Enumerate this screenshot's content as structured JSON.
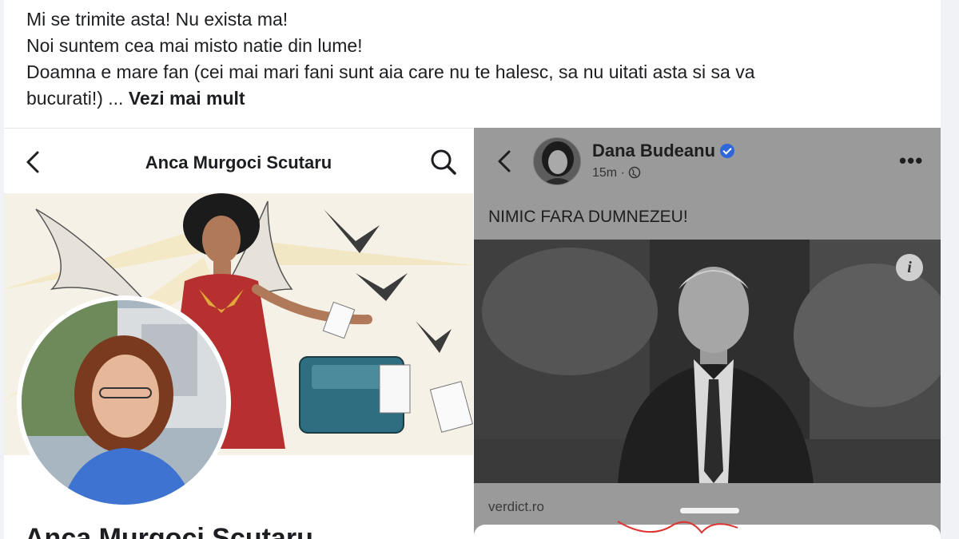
{
  "post": {
    "lines": [
      "Mi se trimite asta! Nu exista ma!",
      "Noi suntem cea mai misto natie din lume!",
      "Doamna e mare fan (cei mai mari fani sunt aia care nu te halesc, sa nu uitati asta si sa va",
      "bucurati!) ... "
    ],
    "see_more": "Vezi mai mult"
  },
  "left_screenshot": {
    "header_title": "Anca Murgoci Scutaru",
    "profile_name": "Anca Murgoci Scutaru",
    "icons": {
      "back": "chevron-left-icon",
      "search": "search-icon"
    }
  },
  "right_screenshot": {
    "author": "Dana Budeanu",
    "time": "15m",
    "separator": " · ",
    "post_text": "NIMIC FARA DUMNEZEU!",
    "info_glyph": "i",
    "link_domain": "verdict.ro",
    "more_glyph": "•••",
    "icons": {
      "back": "chevron-left-icon",
      "audience": "globe-icon",
      "verified": "verified-badge-icon",
      "more": "more-icon",
      "info": "info-icon"
    }
  },
  "colors": {
    "text": "#1c1e21",
    "verified": "#2f66d9",
    "panel_gray": "#9a9a9a"
  }
}
